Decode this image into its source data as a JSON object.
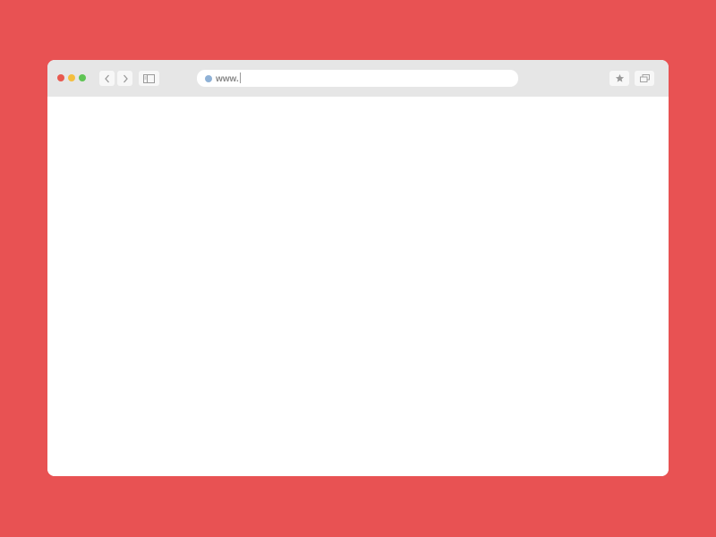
{
  "colors": {
    "background": "#e85253",
    "toolbar": "#e6e6e6",
    "close_light": "#e8594f",
    "minimize_light": "#f4be3e",
    "maximize_light": "#5fc454",
    "address_dot": "#8fb1d6",
    "icon": "#9a9a9a"
  },
  "toolbar": {
    "traffic_lights": [
      "close",
      "minimize",
      "maximize"
    ],
    "back_icon": "chevron-left-icon",
    "forward_icon": "chevron-right-icon",
    "sidebar_icon": "sidebar-icon",
    "bookmark_icon": "star-icon",
    "tabs_icon": "tabs-icon"
  },
  "address_bar": {
    "value": "www."
  }
}
